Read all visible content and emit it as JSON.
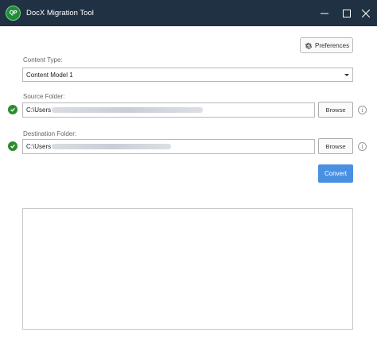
{
  "window": {
    "title": "DocX Migration Tool",
    "logo_text": "QP"
  },
  "toolbar": {
    "preferences_label": "Preferences"
  },
  "content_type": {
    "label": "Content Type:",
    "selected": "Content Model 1"
  },
  "source": {
    "label": "Source Folder:",
    "value": "C:\\Users",
    "browse_label": "Browse",
    "info_glyph": "i"
  },
  "destination": {
    "label": "Destination Folder:",
    "value": "C:\\Users",
    "browse_label": "Browse",
    "info_glyph": "i"
  },
  "actions": {
    "convert_label": "Convert"
  },
  "colors": {
    "titlebar": "#1f3143",
    "accent": "#4a90e2",
    "success": "#2e8b2e"
  },
  "icons": {
    "minimize": "minimize-icon",
    "maximize": "maximize-icon",
    "close": "close-icon",
    "preferences": "gear-icon",
    "valid": "checkmark-icon",
    "info": "info-icon"
  }
}
